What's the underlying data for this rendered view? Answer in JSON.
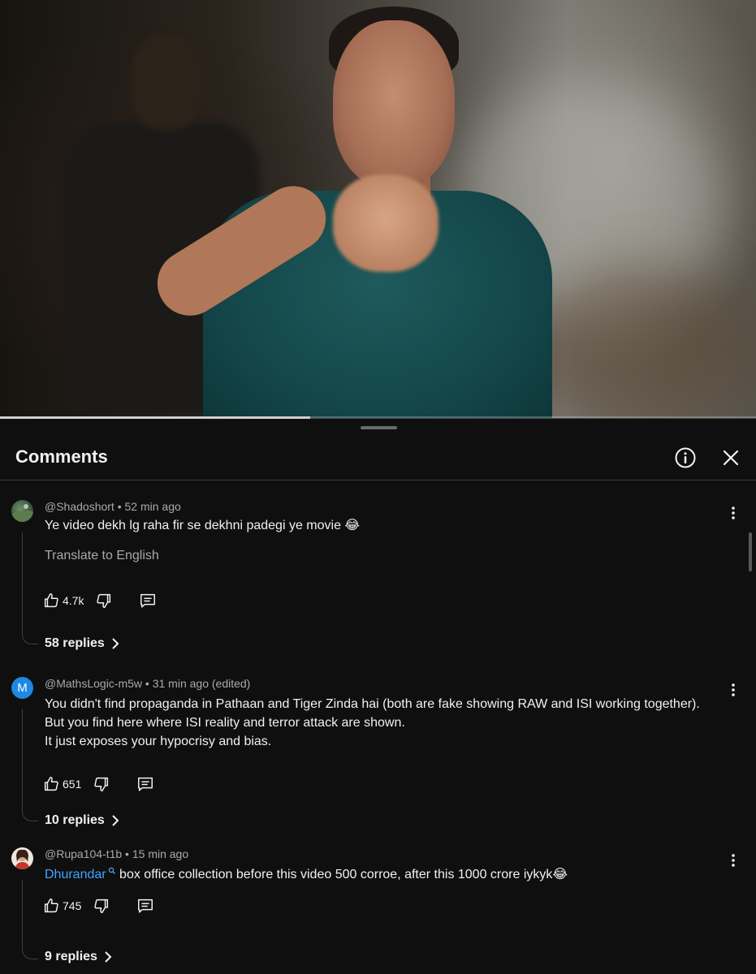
{
  "video": {
    "progress_fraction": 0.41
  },
  "panel": {
    "title": "Comments"
  },
  "comments": [
    {
      "author": "@Shadoshort",
      "age": "52 min ago",
      "text_lines": [
        "Ye video dekh lg raha fir se dekhni padegi ye movie 😂"
      ],
      "translate_label": "Translate to English",
      "likes": "4.7k",
      "replies": "58 replies"
    },
    {
      "author": "@MathsLogic-m5w",
      "avatar_letter": "M",
      "age": "31 min ago (edited)",
      "text_lines": [
        "You didn't find propaganda in Pathaan and Tiger Zinda hai (both are fake showing RAW and ISI working together).",
        "But you find here where ISI reality and terror attack are shown.",
        "It just exposes your hypocrisy and  bias."
      ],
      "likes": "651",
      "replies": "10 replies"
    },
    {
      "author": "@Rupa104-t1b",
      "age": "15 min ago",
      "hashtag": "Dhurandar",
      "text_rest": " box office collection before this video 500 corroe, after this 1000 crore iykyk😂",
      "likes": "745",
      "replies": "9 replies"
    }
  ],
  "colors": {
    "background": "#0f0f0f",
    "text": "#f1f1f1",
    "secondary_text": "#aaaaaa",
    "link_blue": "#3ea6ff",
    "avatar_blue": "#1e88e5"
  },
  "icons": [
    "info-icon",
    "close-icon",
    "like-icon",
    "dislike-icon",
    "reply-icon",
    "chevron-right-icon",
    "more-vert-icon",
    "search-tag-icon"
  ]
}
